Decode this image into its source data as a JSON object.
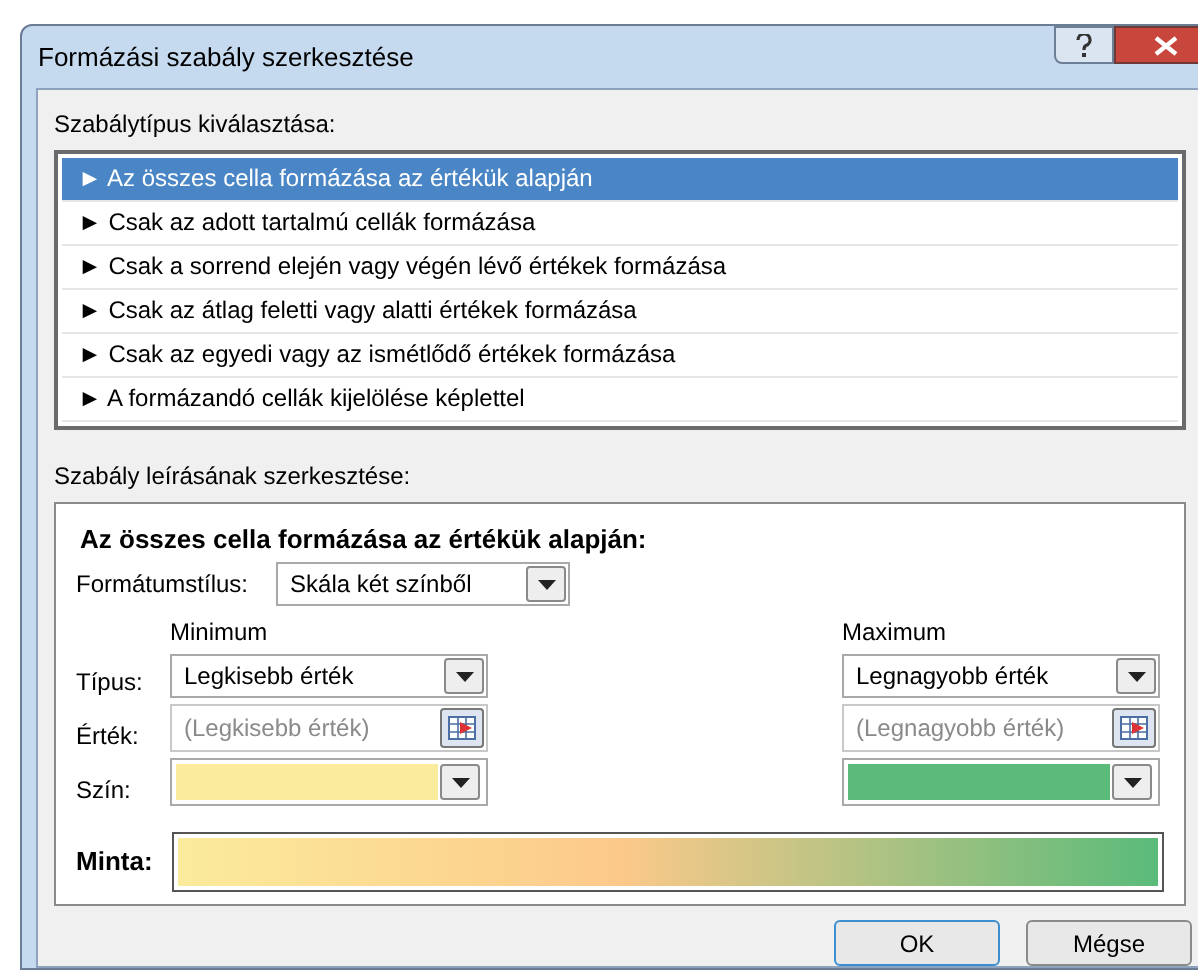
{
  "window": {
    "title": "Formázási szabály szerkesztése"
  },
  "rule_type": {
    "label": "Szabálytípus kiválasztása:",
    "items": [
      {
        "text": "► Az összes cella formázása az értékük alapján",
        "selected": true
      },
      {
        "text": "► Csak az adott tartalmú cellák formázása",
        "selected": false
      },
      {
        "text": "► Csak a sorrend elején vagy végén lévő értékek formázása",
        "selected": false
      },
      {
        "text": "► Csak az átlag feletti vagy alatti értékek formázása",
        "selected": false
      },
      {
        "text": "► Csak az egyedi vagy az ismétlődő értékek formázása",
        "selected": false
      },
      {
        "text": "► A formázandó cellák kijelölése képlettel",
        "selected": false
      }
    ]
  },
  "description": {
    "label": "Szabály leírásának szerkesztése:",
    "heading": "Az összes cella formázása az értékük alapján:",
    "format_style": {
      "label": "Formátumstílus:",
      "value": "Skála két színből"
    },
    "row_labels": [
      "Típus:",
      "Érték:",
      "Szín:"
    ],
    "columns": [
      {
        "title": "Minimum",
        "type": "Legkisebb érték",
        "value_placeholder": "(Legkisebb érték)",
        "color": "#fbeb9c"
      },
      {
        "title": "Maximum",
        "type": "Legnagyobb érték",
        "value_placeholder": "(Legnagyobb érték)",
        "color": "#5abb7a"
      }
    ],
    "sample_label": "Minta:"
  },
  "buttons": [
    "OK",
    "Mégse"
  ]
}
